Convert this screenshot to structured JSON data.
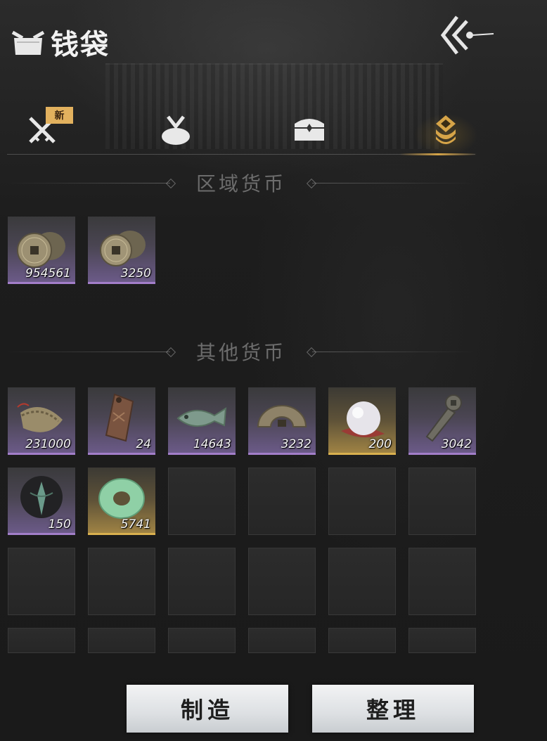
{
  "header": {
    "title": "钱袋",
    "icon": "pouch-icon",
    "back_icon": "back-arrows-icon"
  },
  "tabs": [
    {
      "name": "weapons",
      "icon": "crossed-swords-icon",
      "badge": "新",
      "active": false
    },
    {
      "name": "bundle",
      "icon": "cloth-bundle-icon",
      "active": false
    },
    {
      "name": "chest",
      "icon": "treasure-chest-icon",
      "active": false
    },
    {
      "name": "currency",
      "icon": "coin-stack-icon",
      "active": true
    }
  ],
  "sections": {
    "regional": {
      "title": "区域货币",
      "items": [
        {
          "icon": "copper-coins-icon",
          "qty": "954561",
          "rarity": "purple"
        },
        {
          "icon": "copper-coins-icon",
          "qty": "3250",
          "rarity": "purple"
        }
      ]
    },
    "other": {
      "title": "其他货币",
      "items": [
        {
          "icon": "coin-string-icon",
          "qty": "231000",
          "rarity": "purple"
        },
        {
          "icon": "bronze-token-icon",
          "qty": "24",
          "rarity": "purple"
        },
        {
          "icon": "jade-fish-icon",
          "qty": "14643",
          "rarity": "purple"
        },
        {
          "icon": "half-coin-icon",
          "qty": "3232",
          "rarity": "purple"
        },
        {
          "icon": "pearl-icon",
          "qty": "200",
          "rarity": "gold"
        },
        {
          "icon": "knife-coin-icon",
          "qty": "3042",
          "rarity": "purple"
        },
        {
          "icon": "dark-emblem-icon",
          "qty": "150",
          "rarity": "purple"
        },
        {
          "icon": "jade-ring-icon",
          "qty": "5741",
          "rarity": "gold"
        }
      ]
    }
  },
  "buttons": {
    "craft": "制造",
    "sort": "整理"
  },
  "colors": {
    "accent_gold": "#d6a448",
    "rarity_purple": "#a27ec9",
    "rarity_gold": "#d9b04f"
  }
}
